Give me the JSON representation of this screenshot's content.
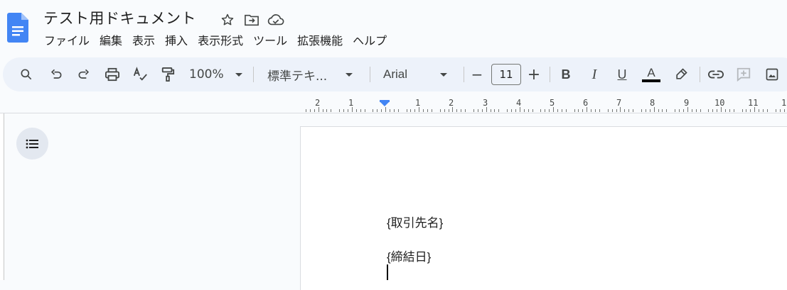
{
  "document": {
    "title": "テスト用ドキュメント"
  },
  "title_icons": [
    "star-icon",
    "move-to-folder-icon",
    "cloud-saved-icon"
  ],
  "menu": [
    "ファイル",
    "編集",
    "表示",
    "挿入",
    "表示形式",
    "ツール",
    "拡張機能",
    "ヘルプ"
  ],
  "toolbar": {
    "zoom": "100%",
    "style": "標準テキ...",
    "font": "Arial",
    "font_size": "11",
    "minus": "−",
    "plus": "+",
    "bold": "B",
    "italic": "I",
    "underline": "U",
    "text_color_letter": "A",
    "text_color": "#000000"
  },
  "ruler": {
    "labels": [
      "2",
      "1",
      "1",
      "2",
      "3",
      "4",
      "5",
      "6",
      "7",
      "8",
      "9",
      "10",
      "11",
      "1"
    ]
  },
  "body": {
    "lines": [
      "{取引先名}",
      "{締結日}"
    ]
  },
  "colors": {
    "accent": "#4285f4",
    "background": "#f9fbfd",
    "toolbar": "#edf2fa"
  }
}
